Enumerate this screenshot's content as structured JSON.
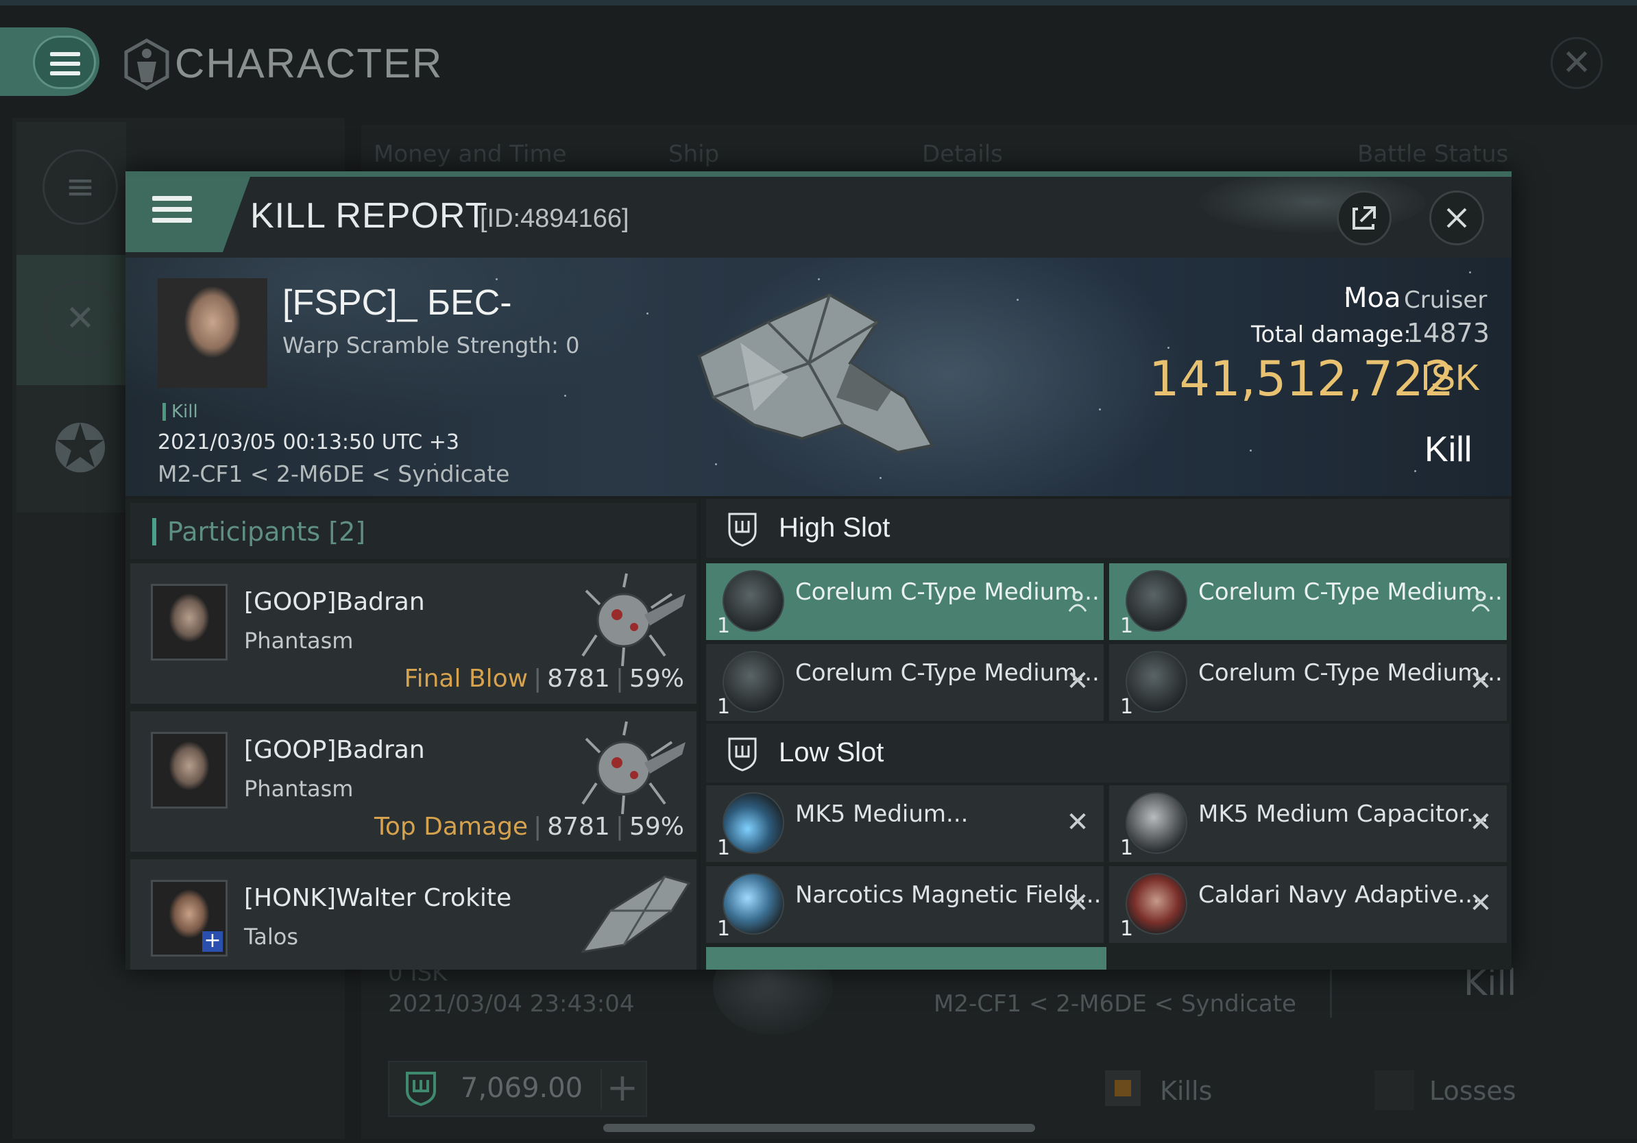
{
  "app": {
    "title": "CHARACTER",
    "tabs": [
      "Money and Time",
      "Ship",
      "Details",
      "Battle Status"
    ]
  },
  "background_row": {
    "isk": "0 ISK",
    "date": "2021/03/04 23:43:04",
    "location": "M2-CF1 < 2-M6DE < Syndicate",
    "result": "Kill"
  },
  "wallet": {
    "amount": "7,069.00"
  },
  "filters": {
    "kills": "Kills",
    "losses": "Losses"
  },
  "report": {
    "title": "KILL REPORT",
    "id_label": "[ID:4894166]",
    "victim": {
      "name": "[FSPC]_ БЕС-",
      "warp_scramble": "Warp Scramble Strength: 0",
      "kill_tag": "Kill",
      "datetime": "2021/03/05 00:13:50 UTC +3",
      "location": "M2-CF1 < 2-M6DE < Syndicate"
    },
    "ship_name": "Moa",
    "ship_class": "Cruiser",
    "damage_label": "Total damage:",
    "damage_value": "14873",
    "isk_value": "141,512,722",
    "isk_unit": "ISK",
    "result": "Kill"
  },
  "participants": {
    "label": "Participants [2]",
    "rows": [
      {
        "name": "[GOOP]Badran",
        "ship": "Phantasm",
        "tag": "Final Blow",
        "damage": "8781",
        "percent": "59%"
      },
      {
        "name": "[GOOP]Badran",
        "ship": "Phantasm",
        "tag": "Top Damage",
        "damage": "8781",
        "percent": "59%"
      },
      {
        "name": "[HONK]Walter Crokite",
        "ship": "Talos"
      }
    ]
  },
  "fittings": {
    "high_slot_label": "High Slot",
    "low_slot_label": "Low Slot",
    "high": [
      {
        "name": "Corelum C-Type Medium...",
        "qty": "1",
        "state": "dropped",
        "icon": "turret-icon",
        "mark_icon": "person-icon"
      },
      {
        "name": "Corelum C-Type Medium...",
        "qty": "1",
        "state": "dropped",
        "icon": "turret-icon",
        "mark_icon": "person-icon"
      },
      {
        "name": "Corelum C-Type Medium...",
        "qty": "1",
        "state": "destroyed",
        "icon": "turret-icon",
        "mark_icon": "x-icon"
      },
      {
        "name": "Corelum C-Type Medium...",
        "qty": "1",
        "state": "destroyed",
        "icon": "turret-icon",
        "mark_icon": "x-icon"
      }
    ],
    "low": [
      {
        "name": "MK5 Medium...",
        "qty": "1",
        "state": "destroyed",
        "icon": "thruster-icon",
        "mark_icon": "x-icon"
      },
      {
        "name": "MK5 Medium Capacitor...",
        "qty": "1",
        "state": "destroyed",
        "icon": "capacitor-icon",
        "mark_icon": "x-icon"
      },
      {
        "name": "Narcotics Magnetic Field...",
        "qty": "1",
        "state": "destroyed",
        "icon": "field-icon",
        "mark_icon": "x-icon"
      },
      {
        "name": "Caldari Navy Adaptive...",
        "qty": "1",
        "state": "destroyed",
        "icon": "shield-hardener-icon",
        "mark_icon": "x-icon"
      }
    ]
  },
  "colors": {
    "accent": "#4a8070",
    "isk": "#e8c271",
    "tag": "#d7a24d"
  }
}
